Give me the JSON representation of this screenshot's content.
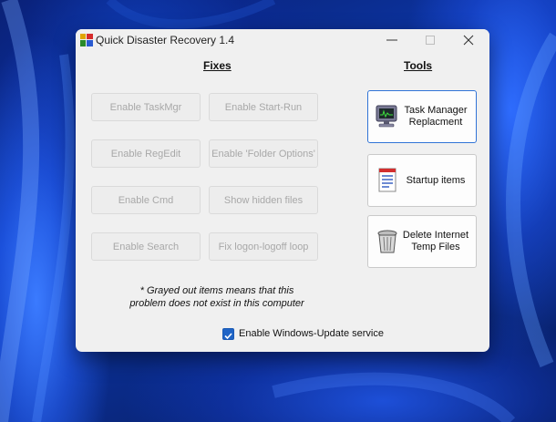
{
  "window": {
    "title": "Quick Disaster Recovery 1.4"
  },
  "fixes": {
    "heading": "Fixes",
    "buttons": [
      {
        "label": "Enable TaskMgr"
      },
      {
        "label": "Enable Start-Run"
      },
      {
        "label": "Enable RegEdit"
      },
      {
        "label": "Enable 'Folder Options'"
      },
      {
        "label": "Enable Cmd"
      },
      {
        "label": "Show hidden files"
      },
      {
        "label": "Enable Search"
      },
      {
        "label": "Fix logon-logoff loop"
      }
    ],
    "note_line1": "* Grayed out items means that this",
    "note_line2": "problem does not exist in this computer"
  },
  "tools": {
    "heading": "Tools",
    "buttons": [
      {
        "label": "Task Manager Replacment",
        "icon": "monitor-icon"
      },
      {
        "label": "Startup items",
        "icon": "document-list-icon"
      },
      {
        "label": "Delete Internet Temp Files",
        "icon": "trash-can-icon"
      }
    ]
  },
  "service": {
    "checkbox_label": "Enable Windows-Update service",
    "checked": true
  },
  "colors": {
    "accent": "#1f64c6",
    "window_bg": "#f0f0f0",
    "disabled_text": "#a8a8a8"
  }
}
